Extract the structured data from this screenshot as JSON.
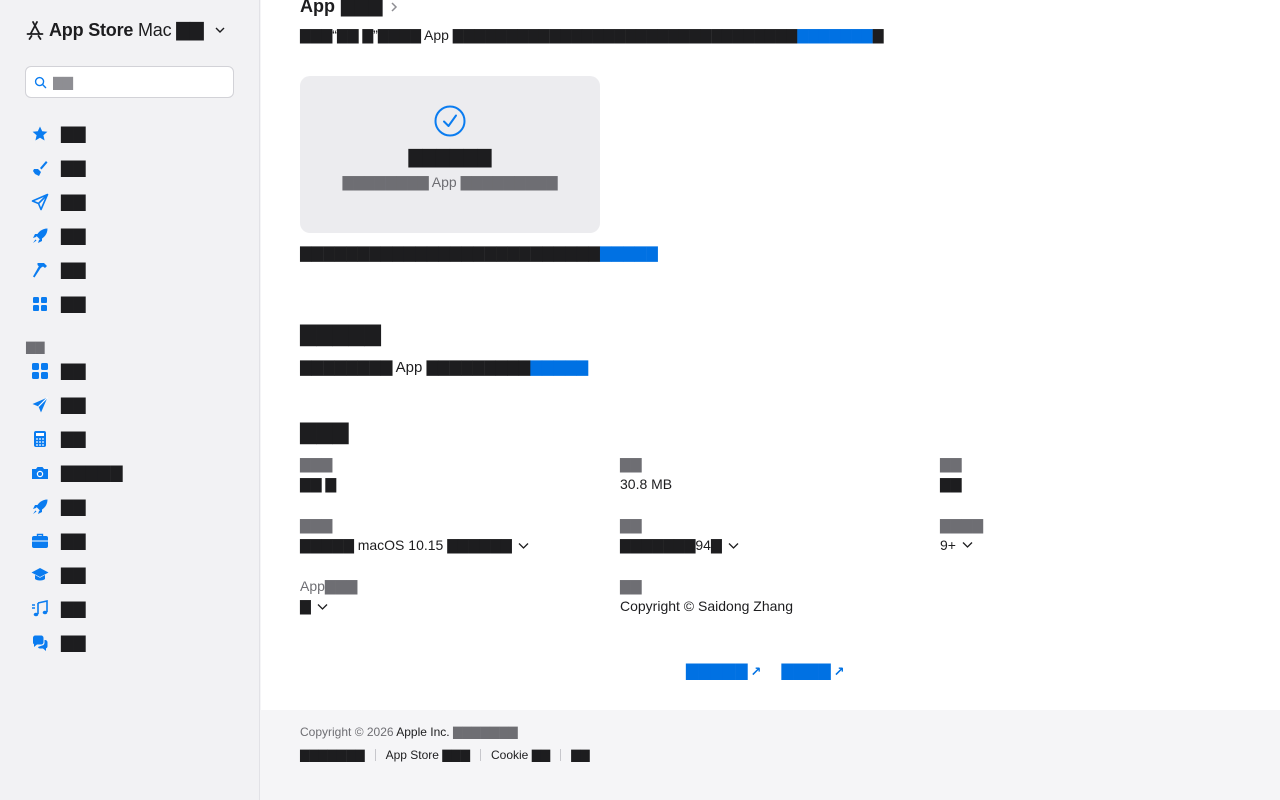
{
  "sidebar": {
    "brand_app_store": "App Store",
    "brand_mac": "Mac",
    "brand_region": "▇▇",
    "search_placeholder": "▇▇",
    "top_items": [
      {
        "icon": "star-icon",
        "label": "▇▇"
      },
      {
        "icon": "brush-icon",
        "label": "▇▇"
      },
      {
        "icon": "paper-plane-icon",
        "label": "▇▇"
      },
      {
        "icon": "rocket-icon",
        "label": "▇▇"
      },
      {
        "icon": "hammer-icon",
        "label": "▇▇"
      },
      {
        "icon": "grid-icon",
        "label": "▇▇"
      }
    ],
    "section_label": "▇▇",
    "category_items": [
      {
        "icon": "grid-icon",
        "label": "▇▇"
      },
      {
        "icon": "paper-plane-icon",
        "label": "▇▇"
      },
      {
        "icon": "calculator-icon",
        "label": "▇▇"
      },
      {
        "icon": "camera-icon",
        "label": "▇▇▇▇▇"
      },
      {
        "icon": "rocket-icon",
        "label": "▇▇"
      },
      {
        "icon": "briefcase-icon",
        "label": "▇▇"
      },
      {
        "icon": "graduation-cap-icon",
        "label": "▇▇"
      },
      {
        "icon": "music-icon",
        "label": "▇▇"
      },
      {
        "icon": "chat-bubbles-icon",
        "label": "▇▇"
      }
    ]
  },
  "main": {
    "app_heading_app": "App",
    "app_heading_rest": "▇▇▇",
    "desc_text": "▇▇▇“▇▇ ▇”▇▇▇▇ App ▇▇▇▇▇▇▇▇▇▇▇▇▇▇▇▇▇▇▇▇▇▇▇▇▇▇▇▇▇▇▇▇",
    "desc_link": "▇▇▇▇▇▇▇",
    "desc_end": "▇",
    "card_title": "▇▇▇▇▇▇",
    "card_sub_pre": "▇▇▇▇▇▇▇▇",
    "card_sub_app": "App",
    "card_sub_post": "▇▇▇▇▇▇▇▇▇",
    "privacy_text": "▇▇▇▇▇▇▇▇▇▇▇▇▇▇▇▇▇▇▇▇▇▇▇▇▇▇",
    "privacy_link": "▇▇▇▇▇",
    "access_title": "▇▇▇▇▇",
    "access_pre": "▇▇▇▇▇▇▇▇",
    "access_app": "App",
    "access_post": "▇▇▇▇▇▇▇▇▇",
    "access_link": "▇▇▇▇▇",
    "info_title": "▇▇▇",
    "info": [
      {
        "key": "▇▇▇",
        "value": "▇▇ ▇",
        "dropdown": false
      },
      {
        "key": "▇▇",
        "value": "30.8 MB",
        "dropdown": false
      },
      {
        "key": "▇▇",
        "value": "▇▇",
        "dropdown": false
      },
      {
        "key": "▇▇▇",
        "value": "▇▇▇▇▇ macOS 10.15 ▇▇▇▇▇▇",
        "dropdown": true
      },
      {
        "key": "▇▇",
        "value": "▇▇▇▇▇▇▇94▇",
        "dropdown": true
      },
      {
        "key": "▇▇▇▇",
        "value": "9+",
        "dropdown": true
      },
      {
        "key": "App▇▇▇",
        "value": "▇",
        "dropdown": true
      },
      {
        "key": "▇▇",
        "value": "Copyright © Saidong Zhang",
        "dropdown": false
      }
    ],
    "link_1": "▇▇▇▇▇",
    "link_2": "▇▇▇▇",
    "link_arrow": "↗"
  },
  "footer": {
    "copy_pre": "Copyright © 2026",
    "company": "Apple Inc.",
    "copy_post": "▇▇▇▇▇▇▇",
    "links": [
      "▇▇▇▇▇▇▇",
      "App Store ▇▇▇",
      "Cookie ▇▇",
      "▇▇"
    ]
  },
  "colors": {
    "accent": "#0071e3",
    "icon_blue": "#0a7cf0"
  }
}
